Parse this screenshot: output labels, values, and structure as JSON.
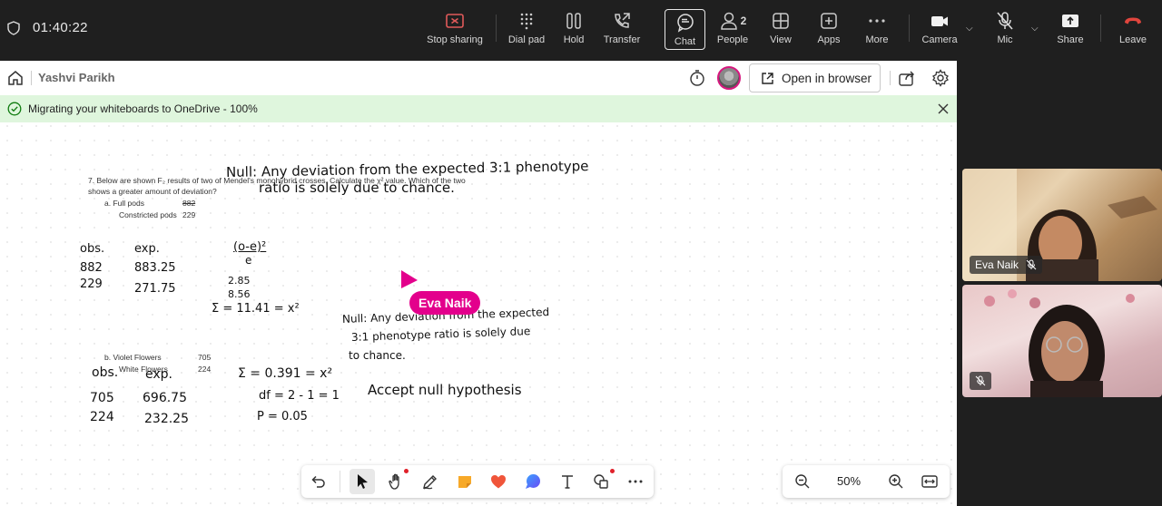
{
  "topbar": {
    "timer": "01:40:22",
    "buttons": {
      "stop_sharing": "Stop sharing",
      "dial_pad": "Dial pad",
      "hold": "Hold",
      "transfer": "Transfer",
      "chat": "Chat",
      "people": "People",
      "people_count": "2",
      "view": "View",
      "apps": "Apps",
      "more": "More",
      "camera": "Camera",
      "mic": "Mic",
      "share": "Share",
      "leave": "Leave"
    },
    "colors": {
      "stop_sharing": "#e05a5a",
      "leave": "#e0453d",
      "background": "#1f1f1f"
    }
  },
  "whiteboard": {
    "owner_name": "Yashvi Parikh",
    "open_in_browser": "Open in browser",
    "banner_text": "Migrating your whiteboards to OneDrive - 100%",
    "cursor_user": "Eva Naik",
    "cursor_color": "#e3008c",
    "zoom_level": "50%",
    "printed": {
      "q7_line1": "7.    Below are shown F₂ results of two of Mendel's monohybrid crosses. Calculate the χ² value. Which of the two",
      "q7_line2": "shows a greater amount of deviation?",
      "part_a": "a.    Full pods",
      "part_a_value": "882",
      "part_a2": "Constricted pods",
      "part_a2_value": "229",
      "part_b": "b.    Violet Flowers",
      "part_b_value": "705",
      "part_b2": "White Flowers",
      "part_b2_value": "224"
    },
    "handwritten": {
      "null1_line1": "Null: Any deviation from the expected 3:1 phenotype",
      "null1_line2": "ratio is solely due to chance.",
      "obs_a": "obs.",
      "exp_a": "exp.",
      "obs_a_1": "882",
      "exp_a_1": "883.25",
      "obs_a_2": "229",
      "exp_a_2": "271.75",
      "formula": "(o-e)²",
      "formula_den": "e",
      "val1": "2.85",
      "val2": "8.56",
      "sum_a": "Σ = 11.41 = x²",
      "null2_line1": "Null: Any deviation from the expected",
      "null2_line2": "3:1 phenotype ratio is solely due",
      "null2_line3": "to chance.",
      "obs_b": "obs.",
      "exp_b": "exp.",
      "obs_b_1": "705",
      "exp_b_1": "696.75",
      "obs_b_2": "224",
      "exp_b_2": "232.25",
      "sum_b": "Σ = 0.391 = x²",
      "df": "df = 2 - 1 = 1",
      "p": "P = 0.05",
      "conclusion": "Accept null hypothesis"
    }
  },
  "participants": [
    {
      "name": "Eva Naik",
      "muted": true
    },
    {
      "name": "",
      "muted": true
    }
  ]
}
